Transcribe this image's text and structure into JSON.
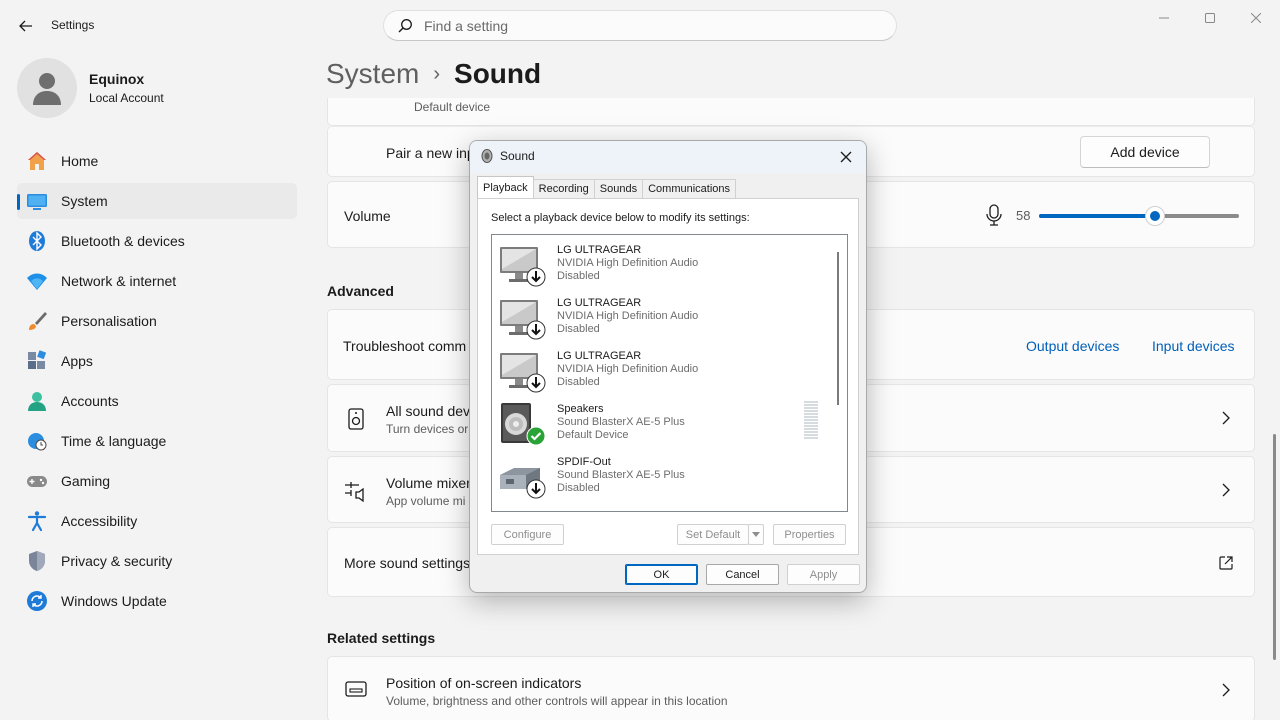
{
  "app": {
    "title": "Settings",
    "back_icon": "back-arrow-icon"
  },
  "search": {
    "placeholder": "Find a setting",
    "icon": "search-icon"
  },
  "window_controls": {
    "minimize_icon": "minimize-icon",
    "maximize_icon": "maximize-icon",
    "close_icon": "close-icon"
  },
  "profile": {
    "name": "Equinox",
    "subtitle": "Local Account",
    "avatar_icon": "avatar-icon"
  },
  "nav": {
    "items": [
      {
        "label": "Home",
        "icon": "home-icon",
        "active": false
      },
      {
        "label": "System",
        "icon": "system-icon",
        "active": true
      },
      {
        "label": "Bluetooth & devices",
        "icon": "bluetooth-icon",
        "active": false
      },
      {
        "label": "Network & internet",
        "icon": "wifi-icon",
        "active": false
      },
      {
        "label": "Personalisation",
        "icon": "brush-icon",
        "active": false
      },
      {
        "label": "Apps",
        "icon": "apps-icon",
        "active": false
      },
      {
        "label": "Accounts",
        "icon": "accounts-icon",
        "active": false
      },
      {
        "label": "Time & language",
        "icon": "globe-clock-icon",
        "active": false
      },
      {
        "label": "Gaming",
        "icon": "gamepad-icon",
        "active": false
      },
      {
        "label": "Accessibility",
        "icon": "accessibility-icon",
        "active": false
      },
      {
        "label": "Privacy & security",
        "icon": "shield-icon",
        "active": false
      },
      {
        "label": "Windows Update",
        "icon": "update-icon",
        "active": false
      }
    ],
    "accent_color": "#0067c0"
  },
  "breadcrumb": {
    "parent": "System",
    "separator": "›",
    "current": "Sound"
  },
  "main": {
    "default_device_text": "Default device",
    "pair_label": "Pair a new inp",
    "add_device_label": "Add device",
    "volume_label": "Volume",
    "volume_value": "58",
    "volume_level": 0.58,
    "advanced_heading": "Advanced",
    "troubleshoot_label": "Troubleshoot comm",
    "output_devices_link": "Output devices",
    "input_devices_link": "Input devices",
    "all_sound_title": "All sound dev",
    "all_sound_sub": "Turn devices or",
    "mixer_title": "Volume mixer",
    "mixer_sub": "App volume mi",
    "more_sound_label": "More sound settings",
    "related_heading": "Related settings",
    "onscreen_title": "Position of on-screen indicators",
    "onscreen_sub": "Volume, brightness and other controls will appear in this location",
    "link_color": "#005fb8"
  },
  "dialog": {
    "title": "Sound",
    "tabs": [
      "Playback",
      "Recording",
      "Sounds",
      "Communications"
    ],
    "active_tab": "Playback",
    "instruction": "Select a playback device below to modify its settings:",
    "devices": [
      {
        "name": "LG ULTRAGEAR",
        "driver": "NVIDIA High Definition Audio",
        "status": "Disabled",
        "icon": "monitor-speaker-icon",
        "badge": "disabled-arrow-icon"
      },
      {
        "name": "LG ULTRAGEAR",
        "driver": "NVIDIA High Definition Audio",
        "status": "Disabled",
        "icon": "monitor-speaker-icon",
        "badge": "disabled-arrow-icon"
      },
      {
        "name": "LG ULTRAGEAR",
        "driver": "NVIDIA High Definition Audio",
        "status": "Disabled",
        "icon": "monitor-speaker-icon",
        "badge": "disabled-arrow-icon"
      },
      {
        "name": "Speakers",
        "driver": "Sound BlasterX AE-5 Plus",
        "status": "Default Device",
        "icon": "speaker-icon",
        "badge": "default-check-icon"
      },
      {
        "name": "SPDIF-Out",
        "driver": "Sound BlasterX AE-5 Plus",
        "status": "Disabled",
        "icon": "spdif-icon",
        "badge": "disabled-arrow-icon"
      }
    ],
    "buttons": {
      "configure": "Configure",
      "set_default": "Set Default",
      "properties": "Properties",
      "ok": "OK",
      "cancel": "Cancel",
      "apply": "Apply"
    }
  }
}
